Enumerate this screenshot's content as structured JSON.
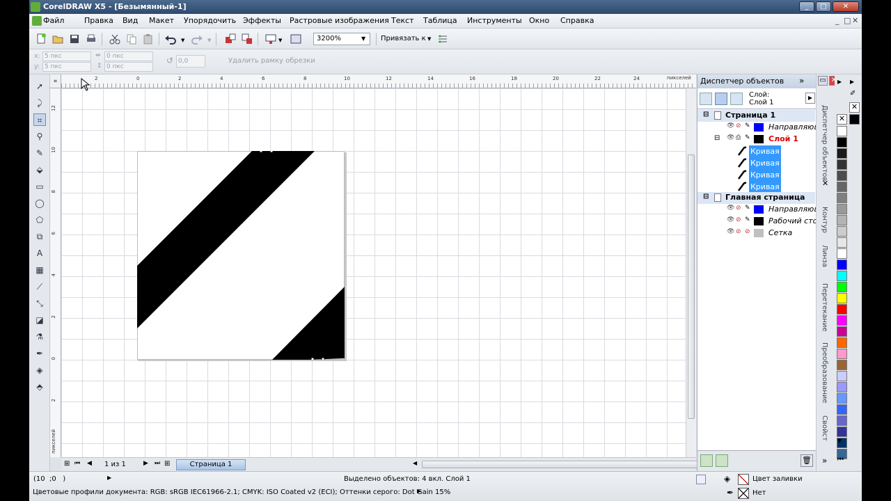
{
  "window": {
    "title": "CorelDRAW X5 - [Безымянный-1]",
    "minimize": "_",
    "maximize": "□",
    "close": "✕"
  },
  "menu": [
    "Файл",
    "Правка",
    "Вид",
    "Макет",
    "Упорядочить",
    "Эффекты",
    "Растровые изображения",
    "Текст",
    "Таблица",
    "Инструменты",
    "Окно",
    "Справка"
  ],
  "menu_right": [
    "_",
    "□",
    "✕"
  ],
  "toolbar": {
    "zoom": "3200%",
    "snap_label": "Привязать к"
  },
  "propbar": {
    "x_label": "x:",
    "x_value": "5 пкс",
    "y_label": "y:",
    "y_value": "5 пкс",
    "w_value": "0 пкс",
    "h_value": "0 пкс",
    "angle": "0,0",
    "delete_crop": "Удалить рамку обрезки"
  },
  "rulers": {
    "unit": "пикселей",
    "h_ticks": [
      "2",
      "0",
      "2",
      "4",
      "6",
      "8",
      "10",
      "12",
      "14",
      "16",
      "18",
      "20",
      "22",
      "24"
    ],
    "v_ticks": [
      "12",
      "10",
      "8",
      "6",
      "4",
      "2",
      "0",
      "2"
    ],
    "v_unit": "пикселей"
  },
  "page_nav": {
    "counter": "1 из 1",
    "page_tab": "Страница 1"
  },
  "docker": {
    "title": "Диспетчер объектов",
    "layer_label": "Слой:",
    "layer_value": "Слой 1",
    "tree": [
      {
        "kind": "page",
        "label": "Страница 1"
      },
      {
        "kind": "layer",
        "label": "Направляющ",
        "color": "#0000ff"
      },
      {
        "kind": "active-layer",
        "label": "Слой 1",
        "color": "#000000"
      },
      {
        "kind": "object",
        "label": "Кривая"
      },
      {
        "kind": "object",
        "label": "Кривая"
      },
      {
        "kind": "object",
        "label": "Кривая"
      },
      {
        "kind": "object",
        "label": "Кривая"
      },
      {
        "kind": "page",
        "label": "Главная страница"
      },
      {
        "kind": "layer",
        "label": "Направляющ",
        "color": "#0000ff"
      },
      {
        "kind": "layer",
        "label": "Рабочий сто",
        "color": "#000000"
      },
      {
        "kind": "layer",
        "label": "Сетка",
        "color": "#c0c0c0"
      }
    ]
  },
  "side_tabs": [
    "Диспетчер объектов",
    "Контур",
    "Линза",
    "Перетекание",
    "Преобразование",
    "Свойст"
  ],
  "palette": [
    "#ffffff",
    "#000000",
    "#1a1a1a",
    "#333333",
    "#4d4d4d",
    "#666666",
    "#808080",
    "#999999",
    "#b3b3b3",
    "#cccccc",
    "#e6e6e6",
    "#ffffff",
    "#0000ff",
    "#00ffff",
    "#00ff00",
    "#ffff00",
    "#ff0000",
    "#ff00ff",
    "#cc0099",
    "#ff6600",
    "#ff99cc",
    "#996633",
    "#ccccff",
    "#9999ff",
    "#6699ff",
    "#3366ff",
    "#6666cc",
    "#333399",
    "#003366",
    "#336699"
  ],
  "status": {
    "coords": "(10  ;0   )",
    "selection": "Выделено объектов: 4 вкл. Слой 1",
    "profiles": "Цветовые профили документа: RGB: sRGB IEC61966-2.1; CMYK: ISO Coated v2 (ECI); Оттенки серого: Dot Gain 15%",
    "fill": "Цвет заливки",
    "outline": "Нет"
  }
}
